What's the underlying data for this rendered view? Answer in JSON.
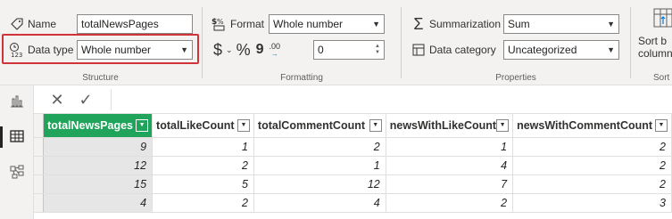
{
  "ribbon": {
    "structure": {
      "group_label": "Structure",
      "name_label": "Name",
      "name_value": "totalNewsPages",
      "datatype_label": "Data type",
      "datatype_value": "Whole number"
    },
    "formatting": {
      "group_label": "Formatting",
      "format_label": "Format",
      "format_value": "Whole number",
      "currency_symbol": "$",
      "percent_symbol": "%",
      "comma_symbol": "9",
      "decimal_symbol": ".00",
      "decimals_value": "0"
    },
    "properties": {
      "group_label": "Properties",
      "summarization_label": "Summarization",
      "summarization_value": "Sum",
      "category_label": "Data category",
      "category_value": "Uncategorized"
    },
    "sort": {
      "group_label": "Sort",
      "button_label_line1": "Sort b",
      "button_label_line2": "column"
    }
  },
  "formula_bar": {
    "cancel_glyph": "✕",
    "commit_glyph": "✓"
  },
  "table": {
    "columns": [
      "totalNewsPages",
      "totalLikeCount",
      "totalCommentCount",
      "newsWithLikeCount",
      "newsWithCommentCount"
    ],
    "selected_column": "totalNewsPages",
    "rows": [
      [
        "9",
        "1",
        "2",
        "1",
        "2"
      ],
      [
        "12",
        "2",
        "1",
        "4",
        "2"
      ],
      [
        "15",
        "5",
        "12",
        "7",
        "2"
      ],
      [
        "4",
        "2",
        "4",
        "2",
        "3"
      ]
    ]
  },
  "colors": {
    "selected_header": "#20a35a",
    "highlight_border": "#d13438",
    "ribbon_bg": "#f3f2f1"
  },
  "icons": {
    "rail": [
      "report-view-icon",
      "table-view-icon",
      "model-view-icon"
    ]
  }
}
